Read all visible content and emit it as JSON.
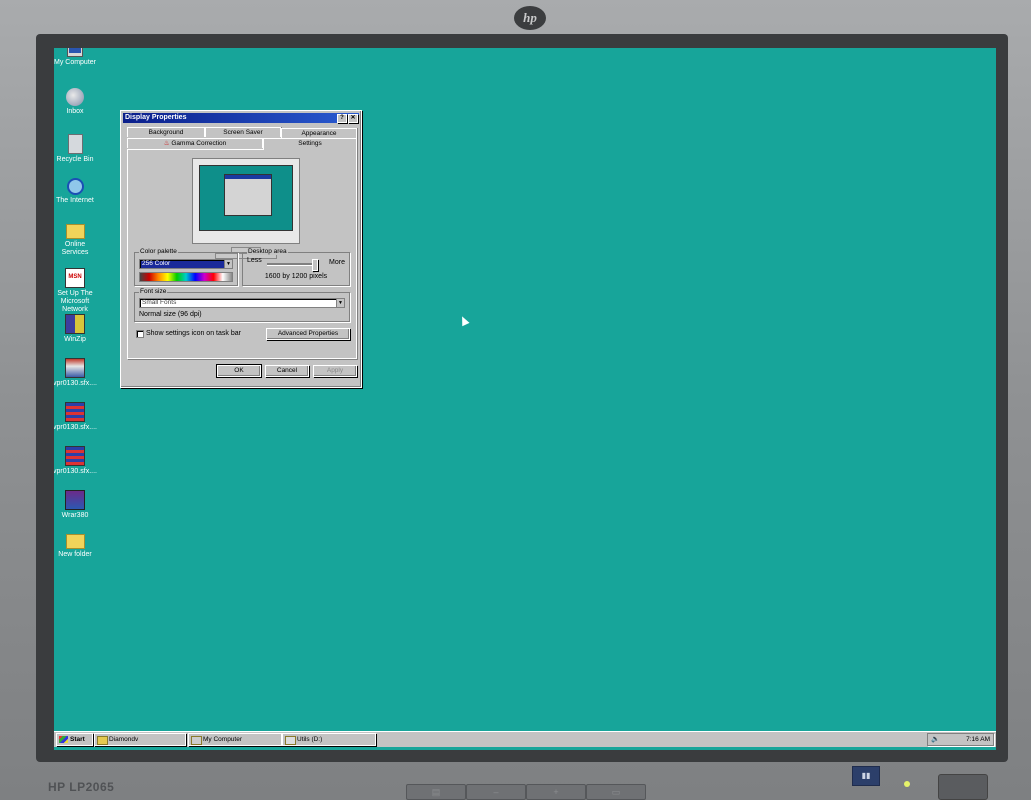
{
  "monitor": {
    "brand_logo": "hp",
    "model": "HP LP2065"
  },
  "desktop": {
    "icons": [
      {
        "label": "My Computer",
        "icon": "computer-icon"
      },
      {
        "label": "Inbox",
        "icon": "inbox-icon"
      },
      {
        "label": "Recycle Bin",
        "icon": "recycle-bin-icon"
      },
      {
        "label": "The Internet",
        "icon": "internet-icon"
      },
      {
        "label": "Online Services",
        "icon": "folder-icon"
      },
      {
        "label": "Set Up The Microsoft Network",
        "icon": "msn-icon"
      },
      {
        "label": "WinZip",
        "icon": "winzip-icon"
      },
      {
        "label": "vpr0130.sfx....",
        "icon": "installer-icon"
      },
      {
        "label": "vpr0130.sfx....",
        "icon": "flag-icon"
      },
      {
        "label": "vpr0130.sfx....",
        "icon": "flag-icon"
      },
      {
        "label": "Wrar380",
        "icon": "winrar-icon"
      },
      {
        "label": "New folder",
        "icon": "folder-icon"
      }
    ]
  },
  "dialog": {
    "title": "Display Properties",
    "help_btn": "?",
    "close_btn": "✕",
    "tabs_row1": [
      "Background",
      "Screen Saver",
      "Appearance"
    ],
    "tabs_row2": [
      "Gamma Correction",
      "Settings"
    ],
    "active_tab": "Settings",
    "color_palette": {
      "label": "Color palette",
      "value": "256 Color"
    },
    "desktop_area": {
      "label": "Desktop area",
      "less": "Less",
      "more": "More",
      "value_text": "1600 by 1200 pixels",
      "slider_fraction": 1.0
    },
    "font_size": {
      "label": "Font size",
      "value": "Small Fonts",
      "description": "Normal size (96 dpi)"
    },
    "show_settings_icon": {
      "label": "Show settings icon on task bar",
      "checked": false
    },
    "advanced_btn": "Advanced Properties",
    "ok_btn": "OK",
    "cancel_btn": "Cancel",
    "apply_btn": "Apply"
  },
  "taskbar": {
    "start_label": "Start",
    "buttons": [
      "Diamondv",
      "My Computer",
      "Utils (D:)"
    ],
    "clock": "7:16 AM"
  }
}
